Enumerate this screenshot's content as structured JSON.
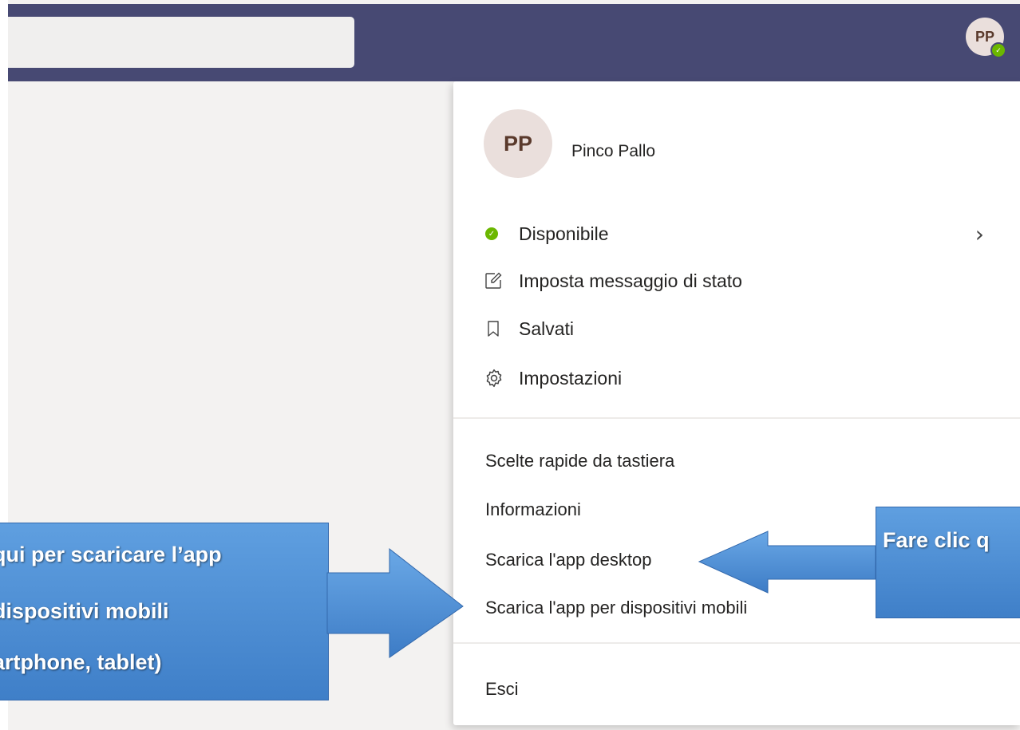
{
  "topbar": {
    "search_placeholder": "",
    "avatar_initials": "PP"
  },
  "profile": {
    "initials": "PP",
    "name": "Pinco Pallo"
  },
  "menu": {
    "status_label": "Disponibile",
    "status_message_label": "Imposta messaggio di stato",
    "saved_label": "Salvati",
    "settings_label": "Impostazioni",
    "shortcuts_label": "Scelte rapide da tastiera",
    "info_label": "Informazioni",
    "desktop_app_label": "Scarica l'app desktop",
    "mobile_app_label": "Scarica l'app per dispositivi mobili",
    "signout_label": "Esci"
  },
  "annotations": {
    "left_lines": [
      "qui per scaricare l’app",
      "dispositivi mobili",
      "artphone, tablet)"
    ],
    "right_line": "Fare clic q"
  },
  "colors": {
    "topbar": "#474973",
    "available": "#6bb700",
    "callout": "#4a8ad4"
  }
}
